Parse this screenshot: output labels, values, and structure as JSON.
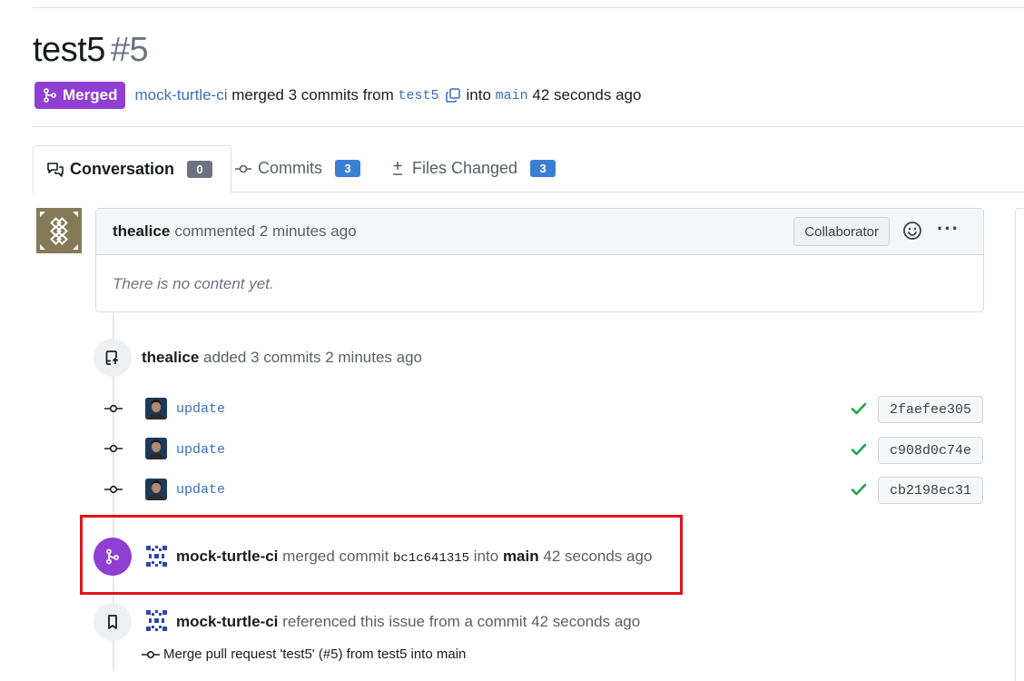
{
  "pr": {
    "title": "test5",
    "number": "#5",
    "status_badge": "Merged",
    "merger": "mock-turtle-ci",
    "merged_text": "merged 3 commits from",
    "head_branch": "test5",
    "into_text": "into",
    "base_branch": "main",
    "time": "42 seconds ago"
  },
  "tabs": [
    {
      "label": "Conversation",
      "count": "0"
    },
    {
      "label": "Commits",
      "count": "3"
    },
    {
      "label": "Files Changed",
      "count": "3"
    }
  ],
  "comment": {
    "author": "thealice",
    "action": "commented 2 minutes ago",
    "role": "Collaborator",
    "body": "There is no content yet."
  },
  "commits_event": {
    "author": "thealice",
    "action": "added 3 commits 2 minutes ago",
    "commits": [
      {
        "message": "update",
        "sha": "2faefee305"
      },
      {
        "message": "update",
        "sha": "c908d0c74e"
      },
      {
        "message": "update",
        "sha": "cb2198ec31"
      }
    ]
  },
  "merge_event": {
    "author": "mock-turtle-ci",
    "action": "merged commit",
    "sha": "bc1c641315",
    "into": "into",
    "branch": "main",
    "time": "42 seconds ago"
  },
  "ref_event": {
    "author": "mock-turtle-ci",
    "action": "referenced this issue from a commit 42 seconds ago",
    "commit_message": "Merge pull request 'test5' (#5) from test5 into main"
  },
  "colors": {
    "merged_purple": "#8f3fd1",
    "link_blue": "#3b6fb7",
    "count_blue": "#3b7fd4",
    "check_green": "#21a34a",
    "highlight_red": "#e3121b"
  },
  "icons": {
    "merge": "git-merge-icon",
    "copy": "copy-icon",
    "conversation": "comments-icon",
    "commits": "git-commit-icon",
    "files": "plus-minus-icon",
    "reaction": "smiley-icon",
    "more": "kebab-icon",
    "push": "repo-push-icon",
    "check": "check-icon",
    "bookmark": "bookmark-icon"
  }
}
